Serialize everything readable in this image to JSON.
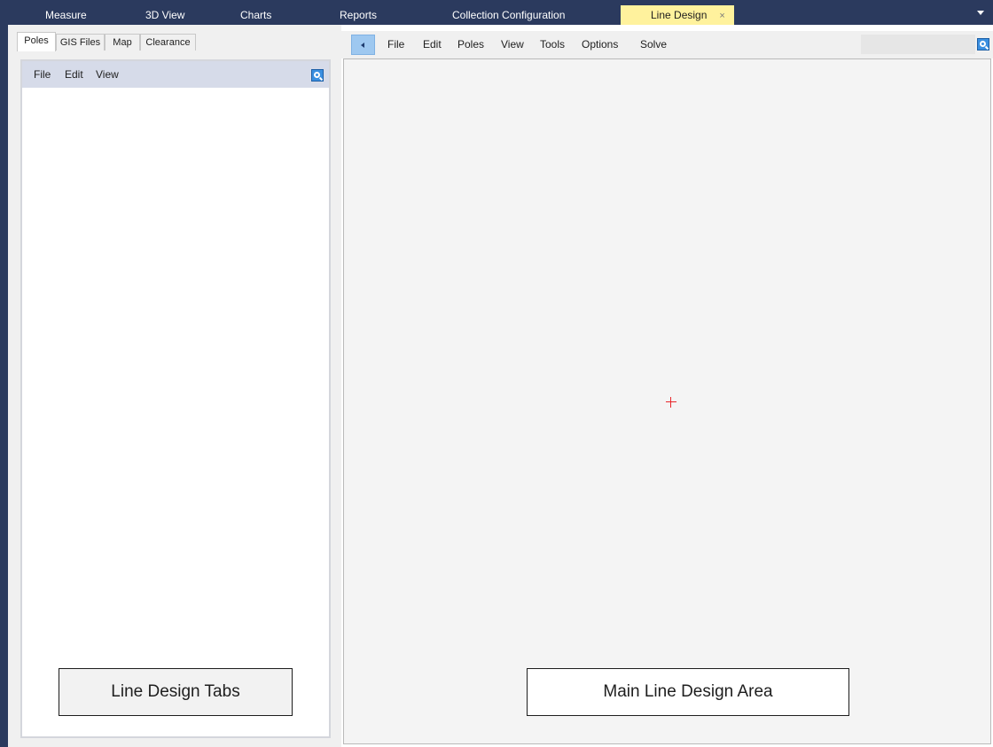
{
  "doc_tabs": [
    {
      "label": "Measure"
    },
    {
      "label": "3D View"
    },
    {
      "label": "Charts"
    },
    {
      "label": "Reports"
    },
    {
      "label": "Collection Configuration"
    },
    {
      "label": "Line Design",
      "active": true,
      "close": "×"
    }
  ],
  "left_panel": {
    "sub_tabs": [
      "Poles",
      "GIS Files",
      "Map",
      "Clearance"
    ],
    "active_sub_tab": "Poles",
    "menu": [
      "File",
      "Edit",
      "View"
    ],
    "search_icon": "search-icon"
  },
  "main_panel": {
    "collapse_icon": "chevron-left-icon",
    "menu": [
      "File",
      "Edit",
      "Poles",
      "View",
      "Tools",
      "Options",
      "Solve"
    ],
    "search_icon": "search-icon",
    "crosshair_icon": "crosshair-icon",
    "crosshair_color": "#e8262a"
  },
  "callouts": {
    "left": "Line Design Tabs",
    "right": "Main Line Design Area"
  },
  "colors": {
    "frame": "#2b3a5e",
    "active_tab": "#fff29d",
    "menubar": "#d6dbe9",
    "accent": "#3a8fe0"
  }
}
